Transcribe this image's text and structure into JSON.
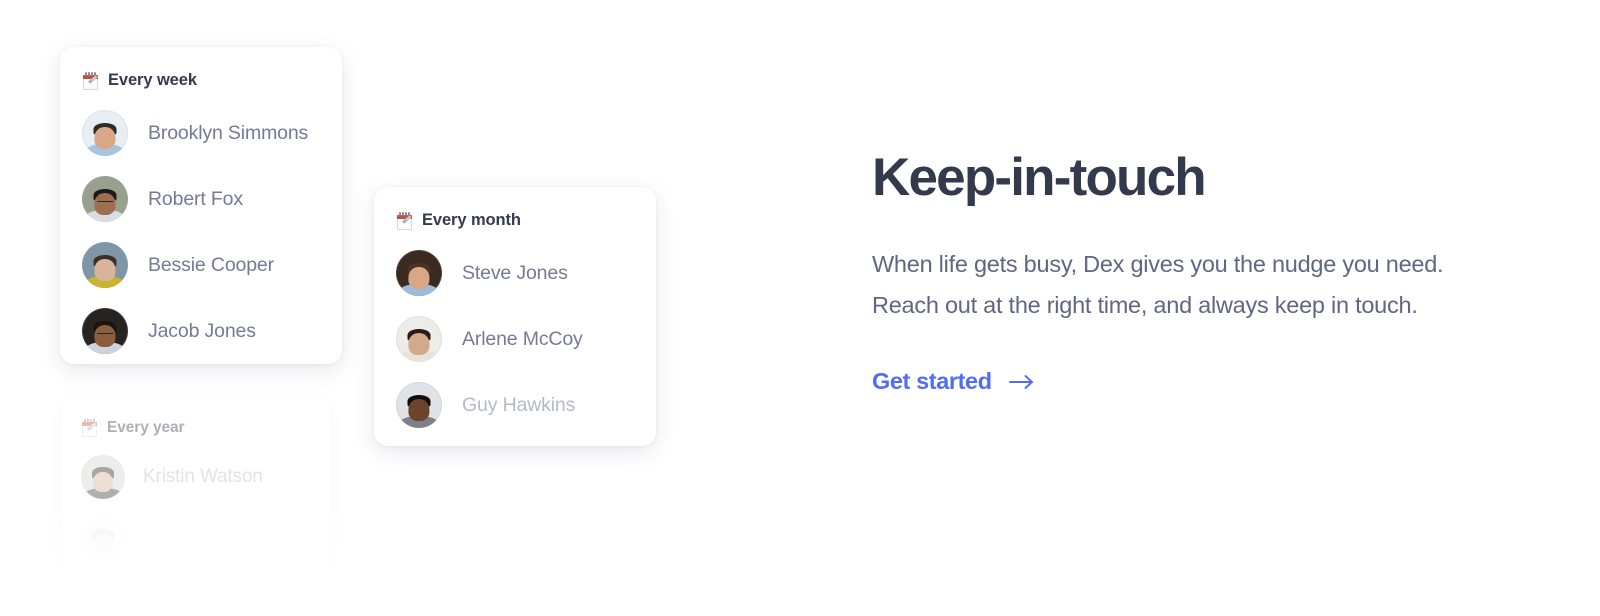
{
  "cards": [
    {
      "id": "every-week",
      "icon": "spiral-notepad-icon",
      "title": "Every week",
      "people": [
        {
          "name": "Brooklyn Simmons",
          "skin": "#d8a889",
          "hair": "#2e2a28",
          "shirt": "#a8c4e0",
          "bg": "#e7eef4",
          "glasses": false
        },
        {
          "name": "Robert Fox",
          "skin": "#9c6f4e",
          "hair": "#1f1a16",
          "shirt": "#d9dee2",
          "bg": "#9aa08e",
          "glasses": true
        },
        {
          "name": "Bessie Cooper",
          "skin": "#d9b49b",
          "hair": "#3a2f29",
          "shirt": "#c9b42c",
          "bg": "#7e96a6",
          "glasses": false
        },
        {
          "name": "Jacob Jones",
          "skin": "#8a5f3f",
          "hair": "#1a1410",
          "shirt": "#cdd3d8",
          "bg": "#272320",
          "glasses": true
        }
      ]
    },
    {
      "id": "every-month",
      "icon": "spiral-notepad-icon",
      "title": "Every month",
      "people": [
        {
          "name": "Steve Jones",
          "skin": "#d7a786",
          "hair": "#4a3326",
          "shirt": "#9dbcd9",
          "bg": "#3b2a20",
          "glasses": false
        },
        {
          "name": "Arlene McCoy",
          "skin": "#d2a98a",
          "hair": "#241c17",
          "shirt": "#e9e4da",
          "bg": "#eeece6",
          "glasses": false
        },
        {
          "name": "Guy Hawkins",
          "skin": "#6b442b",
          "hair": "#120d09",
          "shirt": "#7d8187",
          "bg": "#dfe3e6",
          "glasses": false,
          "muted": true
        }
      ]
    },
    {
      "id": "every-year",
      "icon": "spiral-notepad-icon",
      "title": "Every year",
      "people": [
        {
          "name": "Kristin Watson",
          "skin": "#d6ae92",
          "hair": "#2a2320",
          "shirt": "#3c3a3c",
          "bg": "#d4d7d2",
          "glasses": false,
          "muted": true
        },
        {
          "name": "",
          "skin": "#d6ae92",
          "hair": "#6c655e",
          "shirt": "#d8d8d8",
          "bg": "#f0f0f0",
          "glasses": false,
          "muted": true
        }
      ]
    }
  ],
  "copy": {
    "headline": "Keep-in-touch",
    "body_line_1": "When life gets busy, Dex gives you the nudge you need.",
    "body_line_2": "Reach out at the right time, and always keep in touch.",
    "cta_label": "Get started",
    "cta_icon": "arrow-right-icon"
  },
  "colors": {
    "headline": "#333a4d",
    "body": "#5f6781",
    "link": "#4f6df5",
    "name": "#747b96",
    "name_muted": "#b5bac9",
    "card_bg": "#ffffff",
    "page_bg": "#ffffff"
  }
}
